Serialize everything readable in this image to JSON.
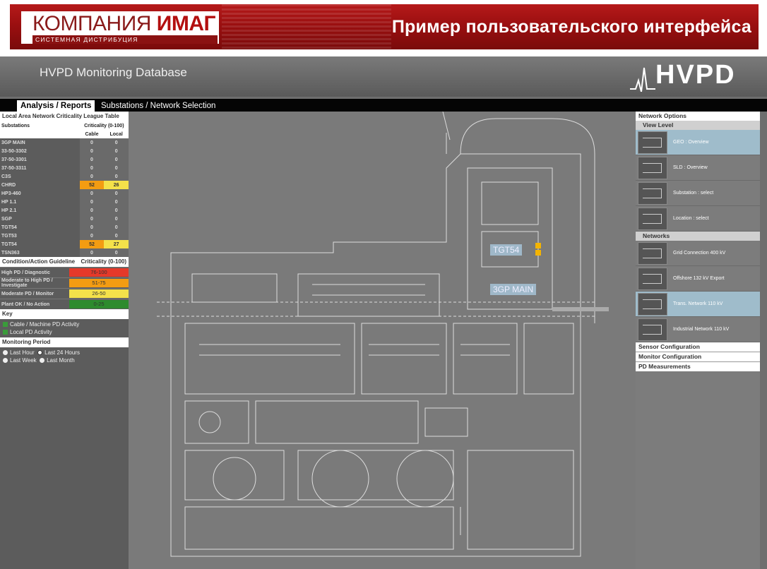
{
  "banner": {
    "logo_text_a": "КОМПАНИЯ",
    "logo_text_b": "ИМАГ",
    "logo_sub": "СИСТЕМНАЯ ДИСТРИБУЦИЯ",
    "title": "Пример пользовательского интерфейса"
  },
  "app": {
    "title": "HVPD Monitoring Database",
    "logo": "HVPD"
  },
  "tabs": {
    "analysis": "Analysis / Reports",
    "substations": "Substations / Network Selection"
  },
  "left": {
    "league_title": "Local Area Network Criticality League Table",
    "col_substations": "Substations",
    "col_criticality": "Criticality (0-100)",
    "col_cable": "Cable",
    "col_local": "Local",
    "rows": [
      {
        "name": "3GP MAIN",
        "cable": "0",
        "local": "0"
      },
      {
        "name": "33-50-3302",
        "cable": "0",
        "local": "0"
      },
      {
        "name": "37-50-3301",
        "cable": "0",
        "local": "0"
      },
      {
        "name": "37-50-3311",
        "cable": "0",
        "local": "0"
      },
      {
        "name": "C3S",
        "cable": "0",
        "local": "0"
      },
      {
        "name": "CHRD",
        "cable": "52",
        "local": "26"
      },
      {
        "name": "HP3-460",
        "cable": "0",
        "local": "0"
      },
      {
        "name": "HP 1.1",
        "cable": "0",
        "local": "0"
      },
      {
        "name": "HP 2.1",
        "cable": "0",
        "local": "0"
      },
      {
        "name": "SGP",
        "cable": "0",
        "local": "0"
      },
      {
        "name": "TGT54",
        "cable": "0",
        "local": "0"
      },
      {
        "name": "TGT53",
        "cable": "0",
        "local": "0"
      },
      {
        "name": "TGT54",
        "cable": "52",
        "local": "27"
      },
      {
        "name": "TSN363",
        "cable": "0",
        "local": "0"
      }
    ],
    "cond_header": "Condition/Action Guideline",
    "cond_crit": "Criticality (0-100)",
    "conditions": [
      {
        "label": "High PD / Diagnostic",
        "range": "76-100",
        "color": "#e5392a"
      },
      {
        "label": "Moderate to High PD / Investigate",
        "range": "51-75",
        "color": "#f39c12"
      },
      {
        "label": "Moderate PD / Monitor",
        "range": "26-50",
        "color": "#f4e14a"
      },
      {
        "label": "Plant OK / No Action",
        "range": "0-25",
        "color": "#2e8b2e"
      }
    ],
    "key_title": "Key",
    "key_items": [
      "Cable / Machine PD Activity",
      "Local PD Activity"
    ],
    "period_title": "Monitoring Period",
    "period_opts": [
      "Last Hour",
      "Last 24 Hours",
      "Last Week",
      "Last Month"
    ]
  },
  "map": {
    "label1": "TGT54",
    "label2": "3GP MAIN"
  },
  "right": {
    "network_options": "Network Options",
    "view_level": "View Level",
    "view_items": [
      "GEO : Overview",
      "SLD : Overview",
      "Substation : select",
      "Location : select"
    ],
    "networks": "Networks",
    "network_items": [
      "Grid Connection 400 kV",
      "Offshore 132 kV Export",
      "Trans. Network 110 kV",
      "Industrial Network 110 kV"
    ],
    "sensor_config": "Sensor Configuration",
    "monitor_config": "Monitor Configuration",
    "pd_measurements": "PD Measurements"
  }
}
